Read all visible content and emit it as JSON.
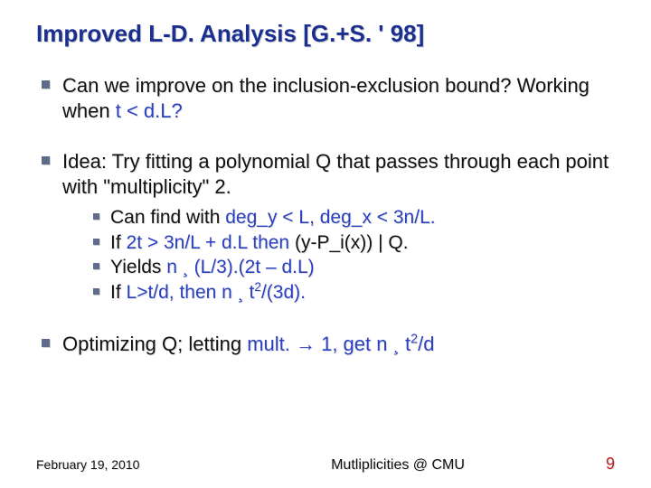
{
  "title": {
    "main": "Improved L-D. Analysis ",
    "cite": "[G.+S. ' 98]"
  },
  "bullets": [
    {
      "segments": [
        {
          "text": "Can we improve on the inclusion-exclusion bound? Working when "
        },
        {
          "text": "t < d.L?",
          "cls": "blue"
        }
      ]
    },
    {
      "segments": [
        {
          "text": "Idea: Try fitting a polynomial Q that passes through each point with \"multiplicity\" 2."
        }
      ],
      "sub": [
        {
          "segments": [
            {
              "text": "Can find with "
            },
            {
              "text": "deg_y < L, deg_x < 3n/L.",
              "cls": "blue"
            }
          ]
        },
        {
          "segments": [
            {
              "text": "If "
            },
            {
              "text": "2t > 3n/L + d.L then ",
              "cls": "blue"
            },
            {
              "text": "(y-P_i(x)) | Q."
            }
          ]
        },
        {
          "segments": [
            {
              "text": "Yields "
            },
            {
              "text": "n ¸ (L/3).(2t – d.L)",
              "cls": "blue"
            }
          ]
        },
        {
          "segments": [
            {
              "text": "If "
            },
            {
              "text": "L>t/d, then n ¸ t",
              "cls": "blue"
            },
            {
              "text": "2",
              "cls": "blue",
              "sup": true
            },
            {
              "text": "/(3d).",
              "cls": "blue"
            }
          ]
        }
      ]
    },
    {
      "segments": [
        {
          "text": "Optimizing Q; letting "
        },
        {
          "text": "mult. ",
          "cls": "blue"
        },
        {
          "text": "→",
          "cls": "blue"
        },
        {
          "text": " 1, get n ¸ t",
          "cls": "blue"
        },
        {
          "text": "2",
          "cls": "blue",
          "sup": true
        },
        {
          "text": "/d",
          "cls": "blue"
        }
      ]
    }
  ],
  "footer": {
    "date": "February 19, 2010",
    "center": "Mutliplicities @ CMU",
    "page": "9"
  }
}
